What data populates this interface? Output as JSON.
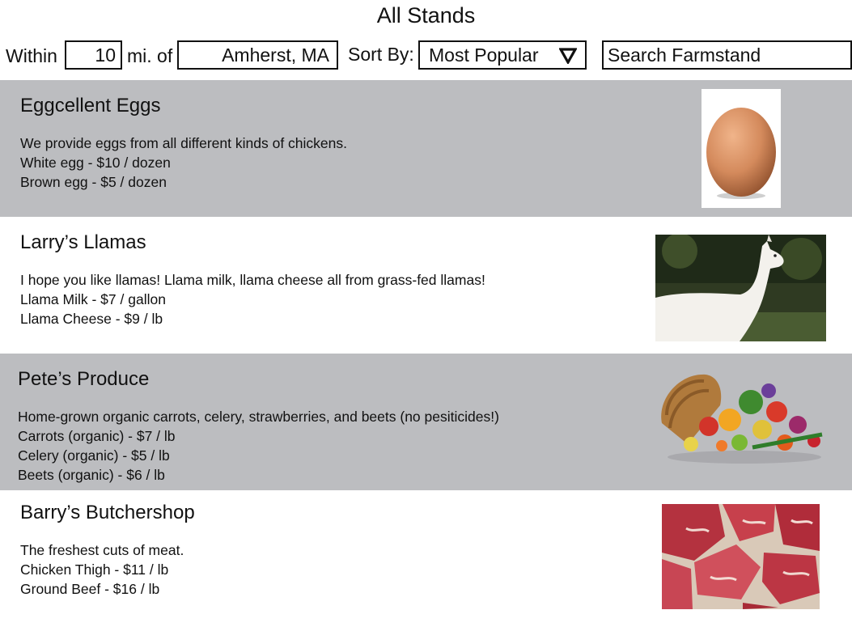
{
  "page": {
    "title": "All Stands"
  },
  "filters": {
    "within_label": "Within",
    "distance_value": "10",
    "miles_of_label": "mi. of",
    "location_value": "Amherst, MA",
    "sort_label": "Sort By:",
    "sort_value": "Most Popular",
    "search_placeholder": "Search Farmstand"
  },
  "stands": [
    {
      "name": "Eggcellent Eggs",
      "description": "We provide eggs from all different kinds of chickens.",
      "items": [
        "White egg - $10 / dozen",
        "Brown egg - $5 / dozen"
      ],
      "image": "egg"
    },
    {
      "name": "Larry’s Llamas",
      "description": "I hope you like llamas! Llama milk, llama cheese all from grass-fed llamas!",
      "items": [
        "Llama Milk - $7 / gallon",
        "Llama Cheese - $9 / lb"
      ],
      "image": "llama"
    },
    {
      "name": "Pete’s Produce",
      "description": "Home-grown organic carrots, celery, strawberries, and beets (no pesiticides!)",
      "items": [
        "Carrots (organic) - $7 / lb",
        "Celery (organic) - $5 / lb",
        "Beets (organic) - $6 / lb"
      ],
      "image": "produce-basket"
    },
    {
      "name": "Barry’s Butchershop",
      "description": "The freshest cuts of meat.",
      "items": [
        "Chicken Thigh - $11 / lb",
        "Ground Beef - $16 / lb"
      ],
      "image": "raw-meat"
    }
  ]
}
